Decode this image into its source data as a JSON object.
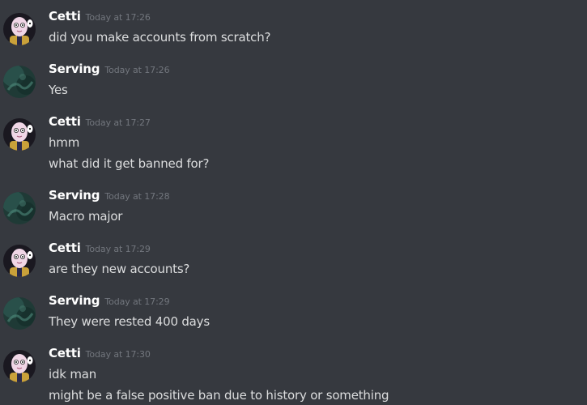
{
  "messages": [
    {
      "user": "Cetti",
      "time": "Today at 17:26",
      "avatar": "cetti-avatar",
      "lines": [
        "did you make accounts from scratch?"
      ]
    },
    {
      "user": "Serving",
      "time": "Today at 17:26",
      "avatar": "serving-avatar",
      "lines": [
        "Yes"
      ]
    },
    {
      "user": "Cetti",
      "time": "Today at 17:27",
      "avatar": "cetti-avatar",
      "lines": [
        "hmm",
        "what did it get banned for?"
      ]
    },
    {
      "user": "Serving",
      "time": "Today at 17:28",
      "avatar": "serving-avatar",
      "lines": [
        "Macro major"
      ]
    },
    {
      "user": "Cetti",
      "time": "Today at 17:29",
      "avatar": "cetti-avatar",
      "lines": [
        "are they new accounts?"
      ]
    },
    {
      "user": "Serving",
      "time": "Today at 17:29",
      "avatar": "serving-avatar",
      "lines": [
        "They were rested 400 days"
      ]
    },
    {
      "user": "Cetti",
      "time": "Today at 17:30",
      "avatar": "cetti-avatar",
      "lines": [
        "idk man",
        "might be a false positive ban due to history or something"
      ]
    }
  ],
  "colors": {
    "background": "#36393f",
    "username": "#ffffff",
    "timestamp": "#72767d",
    "message_text": "#dcddde"
  }
}
